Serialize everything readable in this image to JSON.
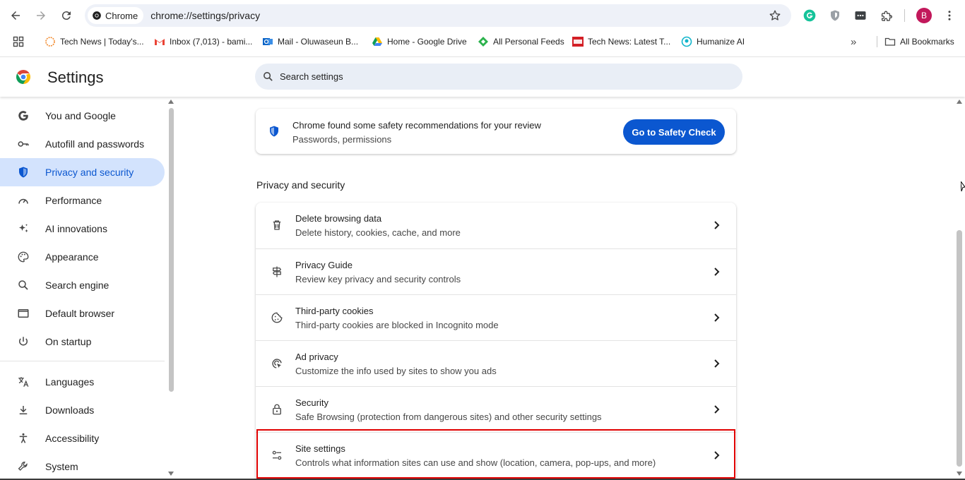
{
  "browser": {
    "chip_label": "Chrome",
    "url": "chrome://settings/privacy",
    "profile_initial": "B"
  },
  "bookmarks": [
    {
      "label": "Tech News | Today's..."
    },
    {
      "label": "Inbox (7,013) - bami..."
    },
    {
      "label": "Mail - Oluwaseun B..."
    },
    {
      "label": "Home - Google Drive"
    },
    {
      "label": "All Personal Feeds"
    },
    {
      "label": "Tech News: Latest T..."
    },
    {
      "label": "Humanize AI"
    }
  ],
  "bookmarks_more": "»",
  "all_bookmarks": "All Bookmarks",
  "settings": {
    "title": "Settings",
    "search_placeholder": "Search settings"
  },
  "sidebar": {
    "items": [
      {
        "label": "You and Google",
        "icon": "google-g-icon"
      },
      {
        "label": "Autofill and passwords",
        "icon": "key-icon"
      },
      {
        "label": "Privacy and security",
        "icon": "shield-icon",
        "active": true
      },
      {
        "label": "Performance",
        "icon": "gauge-icon"
      },
      {
        "label": "AI innovations",
        "icon": "sparkle-icon"
      },
      {
        "label": "Appearance",
        "icon": "palette-icon"
      },
      {
        "label": "Search engine",
        "icon": "search-icon"
      },
      {
        "label": "Default browser",
        "icon": "browser-window-icon"
      },
      {
        "label": "On startup",
        "icon": "power-icon"
      },
      {
        "label": "Languages",
        "icon": "translate-icon"
      },
      {
        "label": "Downloads",
        "icon": "download-icon"
      },
      {
        "label": "Accessibility",
        "icon": "accessibility-icon"
      },
      {
        "label": "System",
        "icon": "wrench-icon"
      }
    ]
  },
  "safety": {
    "title": "Chrome found some safety recommendations for your review",
    "subtitle": "Passwords, permissions",
    "button": "Go to Safety Check"
  },
  "privacy": {
    "section_title": "Privacy and security",
    "rows": [
      {
        "title": "Delete browsing data",
        "sub": "Delete history, cookies, cache, and more",
        "icon": "trash-icon"
      },
      {
        "title": "Privacy Guide",
        "sub": "Review key privacy and security controls",
        "icon": "signpost-icon"
      },
      {
        "title": "Third-party cookies",
        "sub": "Third-party cookies are blocked in Incognito mode",
        "icon": "cookie-icon"
      },
      {
        "title": "Ad privacy",
        "sub": "Customize the info used by sites to show you ads",
        "icon": "ad-target-icon"
      },
      {
        "title": "Security",
        "sub": "Safe Browsing (protection from dangerous sites) and other security settings",
        "icon": "lock-icon"
      },
      {
        "title": "Site settings",
        "sub": "Controls what information sites can use and show (location, camera, pop-ups, and more)",
        "icon": "sliders-icon"
      }
    ]
  },
  "colors": {
    "accent": "#0b57d0",
    "active_bg": "#d3e3fd",
    "highlight": "#e00000"
  }
}
